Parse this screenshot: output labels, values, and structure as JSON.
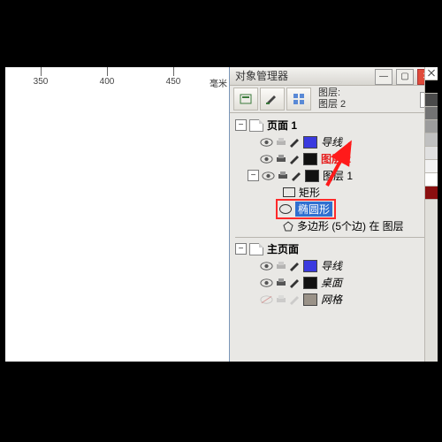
{
  "ruler": {
    "ticks": [
      "350",
      "400",
      "450"
    ],
    "tickx": [
      40,
      115,
      190
    ],
    "unit": "毫米"
  },
  "panel": {
    "title": "对象管理器",
    "headerInfo1": "图层:",
    "headerInfo2": "图层 2"
  },
  "tree": {
    "page1": "页面 1",
    "guides": "导线",
    "layer2": "图层 2",
    "layer1": "图层 1",
    "rect": "矩形",
    "ellipse": "椭圆形",
    "polygon": "多边形 (5个边) 在 图层",
    "master": "主页面",
    "desktop": "桌面",
    "grid": "网格"
  },
  "colors": {
    "guides": "#3a3adf",
    "layer2": "#111111",
    "layer1": "#111111",
    "desktop": "#111111",
    "grid": "#9a9288"
  },
  "swatches": [
    "#000000",
    "#4a4a4a",
    "#737373",
    "#9c9c9c",
    "#c0c0c0",
    "#e0e0e0",
    "#f2f2f2",
    "#ffffff",
    "#8a0f10"
  ]
}
